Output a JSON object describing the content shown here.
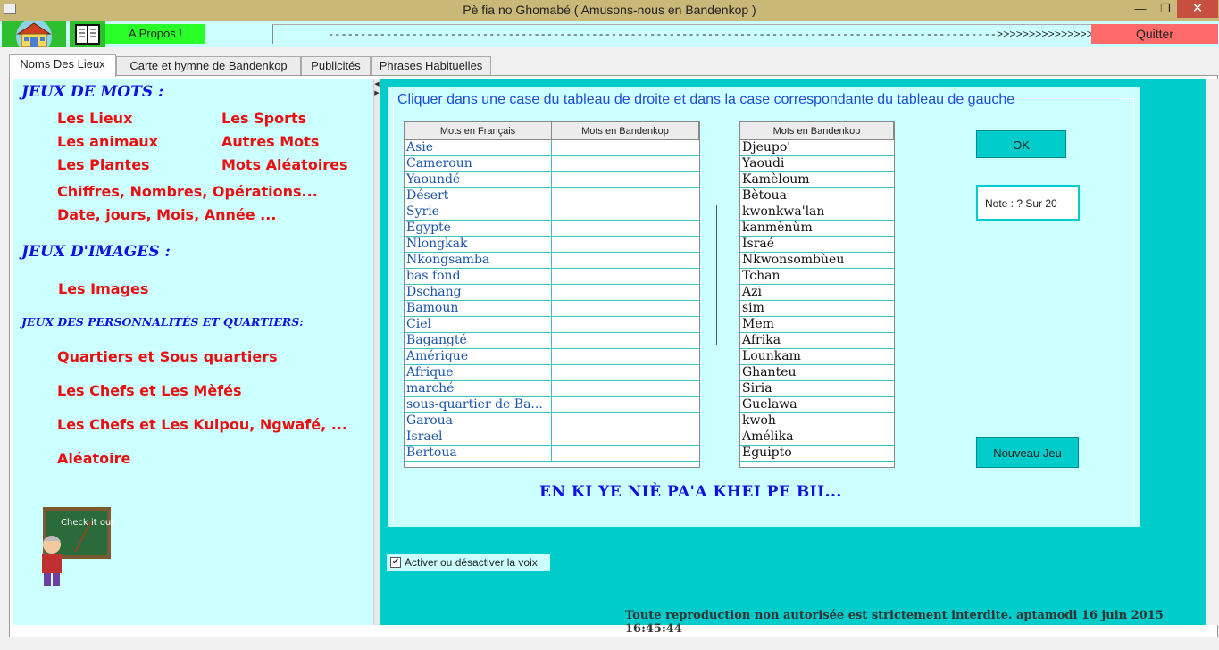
{
  "window": {
    "title": "Pè fia no Ghomabé ( Amusons-nous en Bandenkop )",
    "min_icon": "—",
    "max_icon": "❐",
    "close_icon": "✕"
  },
  "toolbar": {
    "apropos_label": "A Propos !",
    "marquee_text": "-------------------------------------------------------------------------------------------------------->>>>>>>>>>>>>>>",
    "quit_label": "Quitter",
    "icons": [
      "home-icon",
      "book-icon"
    ]
  },
  "tabs": [
    {
      "label": "Noms Des Lieux",
      "active": true
    },
    {
      "label": "Carte et hymne de Bandenkop",
      "active": false
    },
    {
      "label": "Publicités",
      "active": false
    },
    {
      "label": "Phrases Habituelles",
      "active": false
    }
  ],
  "left": {
    "jeux_mots_heading": "JEUX DE MOTS :",
    "links": {
      "lieux": "Les Lieux",
      "sports": "Les Sports",
      "animaux": "Les animaux",
      "autres": "Autres Mots",
      "plantes": "Les Plantes",
      "aleatoires": "Mots Aléatoires",
      "chiffres": "Chiffres, Nombres, Opérations...",
      "dates": "Date, jours, Mois, Année ...",
      "images": "Les Images",
      "quartiers": "Quartiers et Sous quartiers",
      "chefs_mefes": "Les Chefs et Les Mèfés",
      "chefs_kuipou": "Les Chefs et Les Kuipou, Ngwafé, ...",
      "aleatoire": "Aléatoire"
    },
    "jeux_images_heading": "JEUX D'IMAGES :",
    "jeux_perso_heading": "JEUX DES  PERSONNALITÉS ET QUARTIERS:",
    "board_text": "Check it out!"
  },
  "game": {
    "instruction": "Cliquer dans une case du tableau de droite  et dans la case correspondante du tableau de gauche",
    "left_table": {
      "headers": [
        "Mots en Français",
        "Mots en Bandenkop"
      ],
      "rows": [
        "Asie",
        "Cameroun",
        "Yaoundé",
        "Désert",
        "Syrie",
        "Egypte",
        "Nlongkak",
        "Nkongsamba",
        "bas fond",
        "Dschang",
        "Bamoun",
        "Ciel",
        "Bagangté",
        "Amérique",
        "Afrique",
        "marché",
        "sous-quartier de Ba...",
        "Garoua",
        "Israel",
        "Bertoua"
      ]
    },
    "right_table": {
      "header": "Mots en Bandenkop",
      "rows": [
        "Djeupo'",
        "Yaoudi",
        "Kamèloum",
        "Bètoua",
        "kwonkwa'lan",
        "kanmènùm",
        "Israé",
        "Nkwonsombùeu",
        "Tchan",
        "Azi",
        "sim",
        "Mem",
        "Afrika",
        "Lounkam",
        "Ghanteu",
        "Siria",
        "Guelawa",
        "kwoh",
        "Amélika",
        "Eguipto"
      ]
    },
    "ok_label": "OK",
    "note_label": "Note : ? Sur 20",
    "new_game_label": "Nouveau Jeu",
    "slogan": "EN KI YE NIÈ PA'A KHEI PE BII..."
  },
  "voice_label": "Activer ou désactiver la voix",
  "footer": "Toute reproduction non autorisée est strictement interdite.      aptamodi 16 juin 2015 16:45:44",
  "colors": {
    "titlebar": "#c9b877",
    "panel_cyan": "#ccffff",
    "teal": "#00cccc",
    "link_red": "#e81010",
    "heading_blue": "#1010e0",
    "quit_red": "#ff6b6b",
    "green": "#29ff29"
  }
}
